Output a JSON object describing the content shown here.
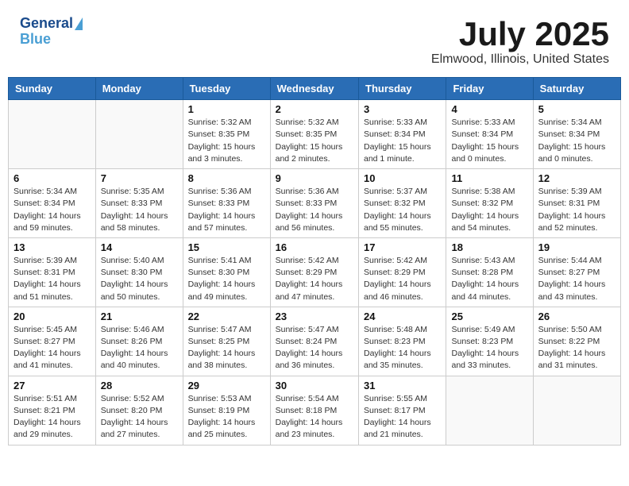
{
  "header": {
    "logo_line1": "General",
    "logo_line2": "Blue",
    "month": "July 2025",
    "location": "Elmwood, Illinois, United States"
  },
  "weekdays": [
    "Sunday",
    "Monday",
    "Tuesday",
    "Wednesday",
    "Thursday",
    "Friday",
    "Saturday"
  ],
  "weeks": [
    [
      {
        "day": "",
        "info": ""
      },
      {
        "day": "",
        "info": ""
      },
      {
        "day": "1",
        "info": "Sunrise: 5:32 AM\nSunset: 8:35 PM\nDaylight: 15 hours and 3 minutes."
      },
      {
        "day": "2",
        "info": "Sunrise: 5:32 AM\nSunset: 8:35 PM\nDaylight: 15 hours and 2 minutes."
      },
      {
        "day": "3",
        "info": "Sunrise: 5:33 AM\nSunset: 8:34 PM\nDaylight: 15 hours and 1 minute."
      },
      {
        "day": "4",
        "info": "Sunrise: 5:33 AM\nSunset: 8:34 PM\nDaylight: 15 hours and 0 minutes."
      },
      {
        "day": "5",
        "info": "Sunrise: 5:34 AM\nSunset: 8:34 PM\nDaylight: 15 hours and 0 minutes."
      }
    ],
    [
      {
        "day": "6",
        "info": "Sunrise: 5:34 AM\nSunset: 8:34 PM\nDaylight: 14 hours and 59 minutes."
      },
      {
        "day": "7",
        "info": "Sunrise: 5:35 AM\nSunset: 8:33 PM\nDaylight: 14 hours and 58 minutes."
      },
      {
        "day": "8",
        "info": "Sunrise: 5:36 AM\nSunset: 8:33 PM\nDaylight: 14 hours and 57 minutes."
      },
      {
        "day": "9",
        "info": "Sunrise: 5:36 AM\nSunset: 8:33 PM\nDaylight: 14 hours and 56 minutes."
      },
      {
        "day": "10",
        "info": "Sunrise: 5:37 AM\nSunset: 8:32 PM\nDaylight: 14 hours and 55 minutes."
      },
      {
        "day": "11",
        "info": "Sunrise: 5:38 AM\nSunset: 8:32 PM\nDaylight: 14 hours and 54 minutes."
      },
      {
        "day": "12",
        "info": "Sunrise: 5:39 AM\nSunset: 8:31 PM\nDaylight: 14 hours and 52 minutes."
      }
    ],
    [
      {
        "day": "13",
        "info": "Sunrise: 5:39 AM\nSunset: 8:31 PM\nDaylight: 14 hours and 51 minutes."
      },
      {
        "day": "14",
        "info": "Sunrise: 5:40 AM\nSunset: 8:30 PM\nDaylight: 14 hours and 50 minutes."
      },
      {
        "day": "15",
        "info": "Sunrise: 5:41 AM\nSunset: 8:30 PM\nDaylight: 14 hours and 49 minutes."
      },
      {
        "day": "16",
        "info": "Sunrise: 5:42 AM\nSunset: 8:29 PM\nDaylight: 14 hours and 47 minutes."
      },
      {
        "day": "17",
        "info": "Sunrise: 5:42 AM\nSunset: 8:29 PM\nDaylight: 14 hours and 46 minutes."
      },
      {
        "day": "18",
        "info": "Sunrise: 5:43 AM\nSunset: 8:28 PM\nDaylight: 14 hours and 44 minutes."
      },
      {
        "day": "19",
        "info": "Sunrise: 5:44 AM\nSunset: 8:27 PM\nDaylight: 14 hours and 43 minutes."
      }
    ],
    [
      {
        "day": "20",
        "info": "Sunrise: 5:45 AM\nSunset: 8:27 PM\nDaylight: 14 hours and 41 minutes."
      },
      {
        "day": "21",
        "info": "Sunrise: 5:46 AM\nSunset: 8:26 PM\nDaylight: 14 hours and 40 minutes."
      },
      {
        "day": "22",
        "info": "Sunrise: 5:47 AM\nSunset: 8:25 PM\nDaylight: 14 hours and 38 minutes."
      },
      {
        "day": "23",
        "info": "Sunrise: 5:47 AM\nSunset: 8:24 PM\nDaylight: 14 hours and 36 minutes."
      },
      {
        "day": "24",
        "info": "Sunrise: 5:48 AM\nSunset: 8:23 PM\nDaylight: 14 hours and 35 minutes."
      },
      {
        "day": "25",
        "info": "Sunrise: 5:49 AM\nSunset: 8:23 PM\nDaylight: 14 hours and 33 minutes."
      },
      {
        "day": "26",
        "info": "Sunrise: 5:50 AM\nSunset: 8:22 PM\nDaylight: 14 hours and 31 minutes."
      }
    ],
    [
      {
        "day": "27",
        "info": "Sunrise: 5:51 AM\nSunset: 8:21 PM\nDaylight: 14 hours and 29 minutes."
      },
      {
        "day": "28",
        "info": "Sunrise: 5:52 AM\nSunset: 8:20 PM\nDaylight: 14 hours and 27 minutes."
      },
      {
        "day": "29",
        "info": "Sunrise: 5:53 AM\nSunset: 8:19 PM\nDaylight: 14 hours and 25 minutes."
      },
      {
        "day": "30",
        "info": "Sunrise: 5:54 AM\nSunset: 8:18 PM\nDaylight: 14 hours and 23 minutes."
      },
      {
        "day": "31",
        "info": "Sunrise: 5:55 AM\nSunset: 8:17 PM\nDaylight: 14 hours and 21 minutes."
      },
      {
        "day": "",
        "info": ""
      },
      {
        "day": "",
        "info": ""
      }
    ]
  ]
}
